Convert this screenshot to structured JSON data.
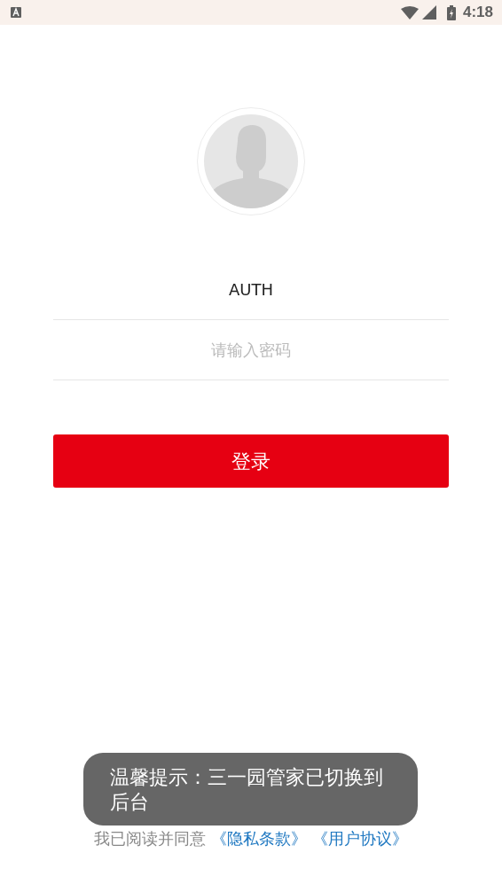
{
  "status_bar": {
    "time": "4:18"
  },
  "login": {
    "username": {
      "value": "AUTH"
    },
    "password": {
      "placeholder": "请输入密码"
    },
    "submit": "登录"
  },
  "agreement": {
    "text": "我已阅读并同意",
    "links": [
      "《隐私条款》",
      "《用户协议》"
    ]
  },
  "toast": {
    "text": "温馨提示：三一园管家已切换到后台"
  }
}
